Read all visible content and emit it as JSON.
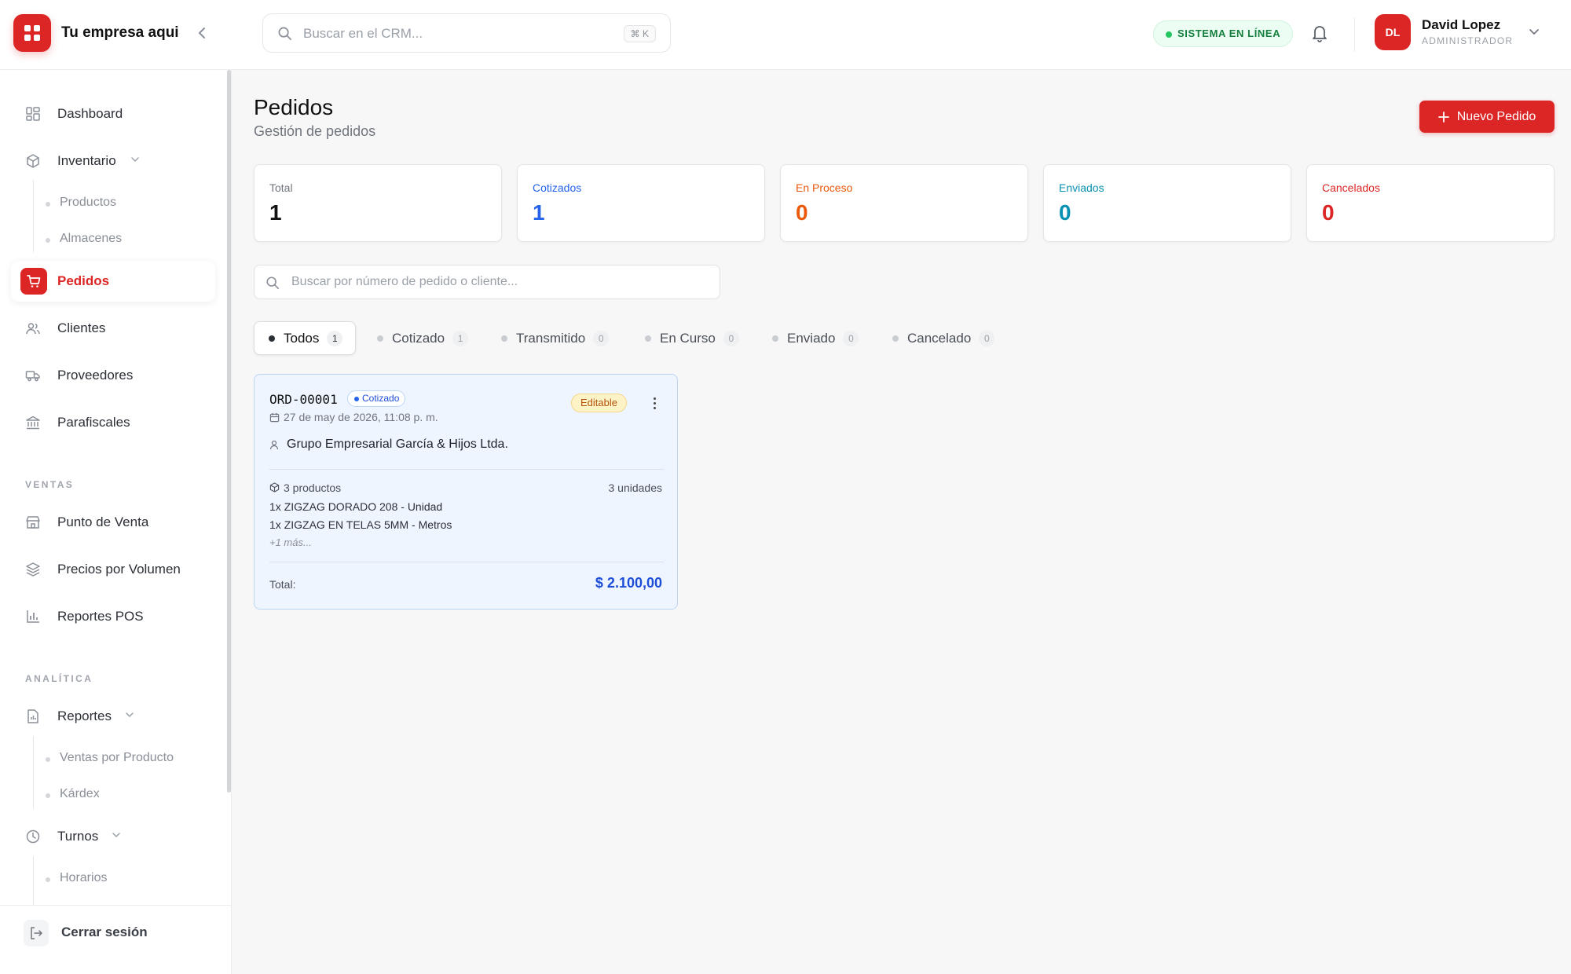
{
  "brand": {
    "name": "Tu empresa aqui"
  },
  "search": {
    "placeholder": "Buscar en el CRM...",
    "shortcut": "⌘ K"
  },
  "status": {
    "label": "SISTEMA EN LÍNEA",
    "color": "#22c55e"
  },
  "user": {
    "initials": "DL",
    "name": "David Lopez",
    "role": "ADMINISTRADOR"
  },
  "sidebar": {
    "items": [
      {
        "label": "Dashboard",
        "icon": "dashboard-icon"
      },
      {
        "label": "Inventario",
        "icon": "box-icon",
        "children": [
          "Productos",
          "Almacenes"
        ]
      },
      {
        "label": "Pedidos",
        "icon": "cart-icon",
        "active": true
      },
      {
        "label": "Clientes",
        "icon": "users-icon"
      },
      {
        "label": "Proveedores",
        "icon": "truck-icon"
      },
      {
        "label": "Parafiscales",
        "icon": "bank-icon"
      }
    ],
    "sections": {
      "ventas": {
        "title": "VENTAS",
        "items": [
          {
            "label": "Punto de Venta",
            "icon": "store-icon"
          },
          {
            "label": "Precios por Volumen",
            "icon": "layers-icon"
          },
          {
            "label": "Reportes POS",
            "icon": "bar-chart-icon"
          }
        ]
      },
      "analitica": {
        "title": "ANALÍTICA",
        "items": [
          {
            "label": "Reportes",
            "icon": "report-icon",
            "children": [
              "Ventas por Producto",
              "Kárdex"
            ]
          },
          {
            "label": "Turnos",
            "icon": "clock-icon",
            "children": [
              "Horarios"
            ]
          }
        ]
      }
    },
    "logout": "Cerrar sesión"
  },
  "page": {
    "title": "Pedidos",
    "subtitle": "Gestión de pedidos",
    "new_button": "Nuevo Pedido",
    "search_placeholder": "Buscar por número de pedido o cliente..."
  },
  "stats": [
    {
      "label": "Total",
      "value": "1",
      "color": "#111111"
    },
    {
      "label": "Cotizados",
      "value": "1",
      "color": "#2563eb"
    },
    {
      "label": "En Proceso",
      "value": "0",
      "color": "#ea580c"
    },
    {
      "label": "Enviados",
      "value": "0",
      "color": "#0891b2"
    },
    {
      "label": "Cancelados",
      "value": "0",
      "color": "#dc2626"
    }
  ],
  "tabs": [
    {
      "label": "Todos",
      "count": "1",
      "active": true
    },
    {
      "label": "Cotizado",
      "count": "1"
    },
    {
      "label": "Transmitido",
      "count": "0"
    },
    {
      "label": "En Curso",
      "count": "0"
    },
    {
      "label": "Enviado",
      "count": "0"
    },
    {
      "label": "Cancelado",
      "count": "0"
    }
  ],
  "order": {
    "id": "ORD-00001",
    "status": "Cotizado",
    "editable": "Editable",
    "date": "27 de may de 2026, 11:08 p. m.",
    "client": "Grupo Empresarial García & Hijos Ltda.",
    "products_count": "3 productos",
    "units": "3 unidades",
    "lines": [
      {
        "qty": "1x",
        "name": "ZIGZAG DORADO 208 - Unidad"
      },
      {
        "qty": "1x",
        "name": "ZIGZAG EN TELAS 5MM - Metros"
      }
    ],
    "more": "+1 más...",
    "total_label": "Total:",
    "total": "$ 2.100,00"
  }
}
